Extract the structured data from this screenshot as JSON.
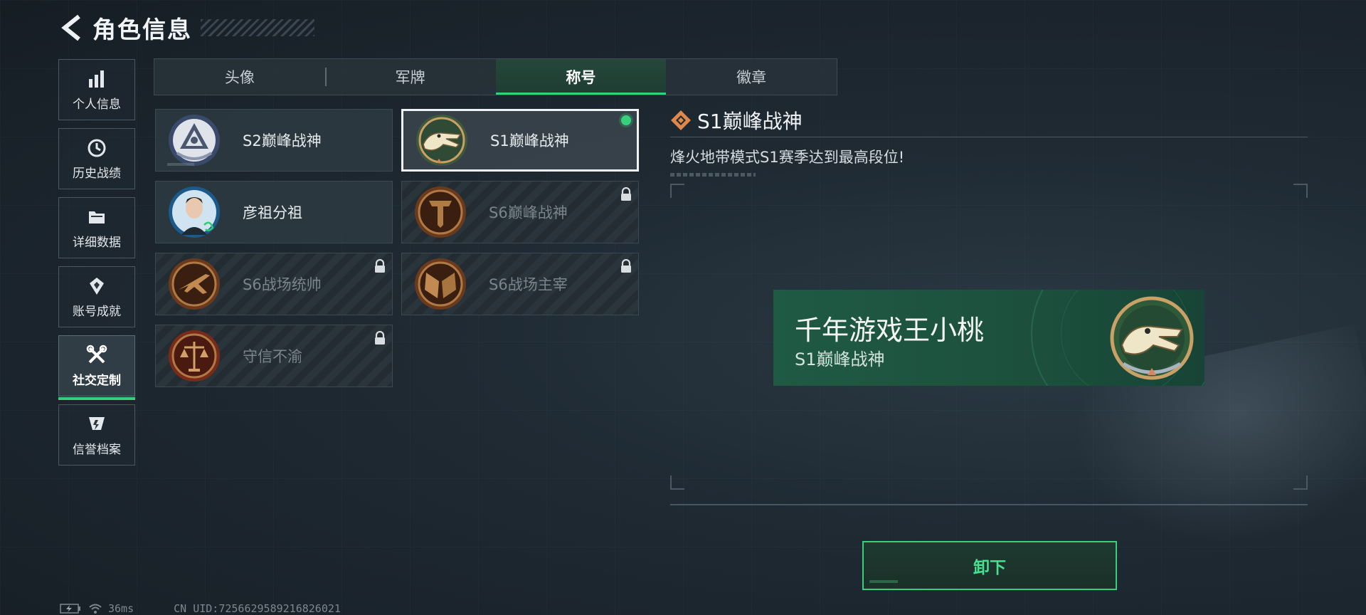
{
  "header": {
    "title": "角色信息",
    "back_icon": "back-chevron-icon"
  },
  "nav": {
    "items": [
      {
        "label": "个人信息",
        "icon": "bar-chart-icon",
        "active": false
      },
      {
        "label": "历史战绩",
        "icon": "history-clock-icon",
        "active": false
      },
      {
        "label": "详细数据",
        "icon": "folder-icon",
        "active": false
      },
      {
        "label": "账号成就",
        "icon": "achievement-icon",
        "active": false
      },
      {
        "label": "社交定制",
        "icon": "wrench-cross-icon",
        "active": true
      },
      {
        "label": "信誉档案",
        "icon": "credit-shield-icon",
        "active": false
      }
    ]
  },
  "tabs": [
    {
      "label": "头像",
      "active": false
    },
    {
      "label": "军牌",
      "active": false
    },
    {
      "label": "称号",
      "active": true
    },
    {
      "label": "徽章",
      "active": false
    }
  ],
  "titles": [
    {
      "label": "S2巅峰战神",
      "locked": false,
      "selected": false,
      "equipped": false,
      "emblem": "triangle-laurel-emblem"
    },
    {
      "label": "S1巅峰战神",
      "locked": false,
      "selected": true,
      "equipped": true,
      "emblem": "crocodile-emblem"
    },
    {
      "label": "彦祖分祖",
      "locked": false,
      "selected": false,
      "equipped": false,
      "emblem": "portrait-emblem"
    },
    {
      "label": "S6巅峰战神",
      "locked": true,
      "selected": false,
      "equipped": false,
      "emblem": "t-shield-emblem"
    },
    {
      "label": "S6战场统帅",
      "locked": true,
      "selected": false,
      "equipped": false,
      "emblem": "jet-emblem"
    },
    {
      "label": "S6战场主宰",
      "locked": true,
      "selected": false,
      "equipped": false,
      "emblem": "crossed-flags-emblem"
    },
    {
      "label": "守信不渝",
      "locked": true,
      "selected": false,
      "equipped": false,
      "emblem": "scales-emblem"
    }
  ],
  "detail": {
    "title": "S1巅峰战神",
    "description": "烽火地带模式S1赛季达到最高段位!"
  },
  "preview": {
    "player_name": "千年游戏王小桃",
    "title": "S1巅峰战神"
  },
  "actions": {
    "unequip_label": "卸下"
  },
  "status": {
    "ping": "36ms",
    "uid": "CN UID:725662958921682​6021"
  },
  "colors": {
    "accent": "#36d07c",
    "card_green": "#1f5a44",
    "emblem_gold": "#c9a066"
  }
}
